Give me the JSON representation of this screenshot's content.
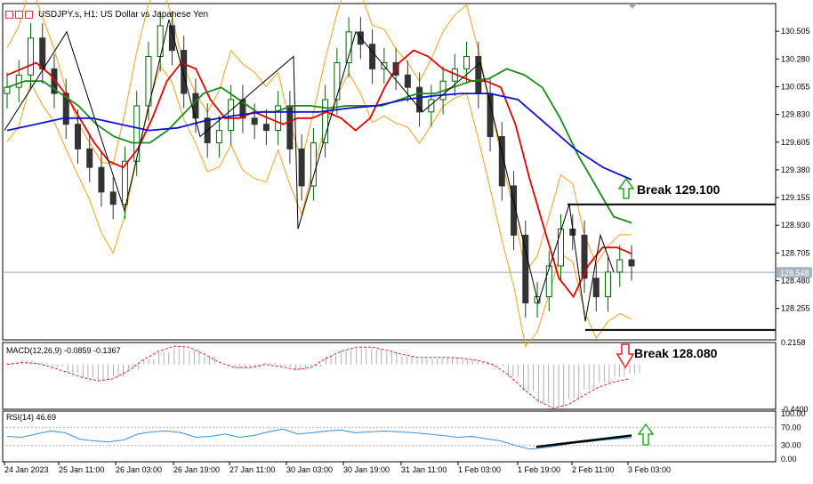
{
  "window": {
    "title": "USDJPY.s, H1:  US Dollar vs Japanese Yen"
  },
  "annotations": {
    "break_up": "Break 129.100",
    "break_down": "Break 128.080"
  },
  "indicators": {
    "macd_label": "MACD(12,26,9) -0.0859 -0.1367",
    "rsi_label": "RSI(14) 46.69"
  },
  "colors": {
    "bullish_candle": "#006400",
    "bearish_candle": "#333333",
    "ma_fast": "#e00000",
    "ma_mid": "#1a8a1a",
    "ma_slow": "#1010d0",
    "bollinger": "#f0a020",
    "up_arrow": "#22aa22",
    "down_arrow": "#dd2222",
    "rsi_line": "#3a8fd8",
    "macd_signal": "#dd2222",
    "histogram": "#b0b0b0"
  },
  "chart_data": {
    "type": "candlestick",
    "symbol": "USDJPY.s",
    "timeframe": "H1",
    "title": "USDJPY.s, H1:  US Dollar vs Japanese Yen",
    "ylim": [
      128.0,
      130.73
    ],
    "y_ticks": [
      "130.505",
      "130.280",
      "130.055",
      "129.830",
      "129.605",
      "129.380",
      "129.155",
      "128.930",
      "128.705",
      "128.480",
      "128.255"
    ],
    "current_price": "128.548",
    "x_tick_labels": [
      "24 Jan 2023",
      "25 Jan 11:00",
      "26 Jan 03:00",
      "26 Jan 19:00",
      "27 Jan 11:00",
      "30 Jan 03:00",
      "30 Jan 19:00",
      "31 Jan 11:00",
      "1 Feb 03:00",
      "1 Feb 19:00",
      "2 Feb 11:00",
      "3 Feb 03:00"
    ],
    "close_series": [
      130.05,
      130.15,
      130.45,
      130.2,
      130.0,
      129.75,
      129.55,
      129.4,
      129.2,
      129.1,
      129.45,
      129.9,
      130.3,
      130.55,
      130.35,
      130.0,
      129.8,
      129.6,
      129.7,
      129.95,
      129.8,
      129.75,
      129.7,
      129.9,
      129.55,
      129.25,
      129.6,
      129.95,
      130.25,
      130.5,
      130.4,
      130.2,
      130.25,
      130.15,
      130.05,
      129.85,
      129.95,
      130.1,
      130.2,
      130.3,
      130.0,
      129.65,
      129.25,
      128.85,
      128.3,
      128.35,
      128.6,
      128.9,
      128.85,
      128.5,
      128.35,
      128.55,
      128.65,
      128.6
    ],
    "support_line": 128.08,
    "resistance_line": 129.1,
    "series": [
      {
        "name": "MA fast",
        "color": "#e00000",
        "values": [
          130.15,
          130.2,
          130.25,
          130.15,
          130.0,
          129.8,
          129.6,
          129.45,
          129.4,
          129.55,
          129.8,
          130.1,
          130.25,
          130.2,
          129.95,
          129.8,
          129.8,
          129.85,
          129.8,
          129.75,
          129.8,
          129.8,
          129.85,
          129.8,
          129.7,
          129.8,
          130.05,
          130.25,
          130.35,
          130.3,
          130.2,
          130.15,
          130.1,
          130.1,
          130.05,
          129.75,
          129.3,
          128.9,
          128.5,
          128.35,
          128.6,
          128.75,
          128.75,
          128.7
        ]
      },
      {
        "name": "MA mid",
        "color": "#1a8a1a",
        "values": [
          130.05,
          130.1,
          130.1,
          130.0,
          129.9,
          129.75,
          129.65,
          129.6,
          129.6,
          129.7,
          129.85,
          130.0,
          130.05,
          129.95,
          129.85,
          129.85,
          129.9,
          129.9,
          129.88,
          129.9,
          129.9,
          129.9,
          129.95,
          130.0,
          130.0,
          130.05,
          130.1,
          130.12,
          130.2,
          130.15,
          130.05,
          129.8,
          129.5,
          129.25,
          129.0,
          128.95
        ]
      },
      {
        "name": "MA slow",
        "color": "#1010d0",
        "values": [
          129.7,
          129.75,
          129.8,
          129.8,
          129.75,
          129.7,
          129.72,
          129.78,
          129.82,
          129.85,
          129.85,
          129.85,
          129.88,
          129.9,
          129.95,
          129.98,
          130.0,
          130.0,
          129.95,
          129.75,
          129.55,
          129.4,
          129.3
        ]
      }
    ],
    "macd": {
      "ylim": [
        -0.44,
        0.2158
      ],
      "y_ticks": [
        "0.2158",
        "-0.4400"
      ],
      "macd_value": -0.0859,
      "signal_value": -0.1367,
      "histogram": [
        0.02,
        0.04,
        0.02,
        -0.02,
        -0.08,
        -0.13,
        -0.15,
        -0.12,
        -0.05,
        0.05,
        0.12,
        0.16,
        0.14,
        0.08,
        0.0,
        -0.04,
        -0.03,
        0.02,
        -0.02,
        -0.06,
        -0.02,
        0.08,
        0.14,
        0.16,
        0.15,
        0.12,
        0.08,
        0.05,
        0.06,
        0.07,
        0.05,
        0.03,
        -0.02,
        -0.12,
        -0.26,
        -0.38,
        -0.42,
        -0.34,
        -0.25,
        -0.18,
        -0.12,
        -0.09
      ],
      "signal": [
        0.0,
        0.02,
        0.01,
        -0.03,
        -0.08,
        -0.13,
        -0.16,
        -0.14,
        -0.06,
        0.05,
        0.13,
        0.18,
        0.17,
        0.1,
        0.02,
        -0.03,
        -0.03,
        0.0,
        -0.02,
        -0.05,
        -0.03,
        0.06,
        0.13,
        0.17,
        0.17,
        0.14,
        0.1,
        0.07,
        0.07,
        0.07,
        0.06,
        0.04,
        0.0,
        -0.1,
        -0.24,
        -0.36,
        -0.43,
        -0.39,
        -0.3,
        -0.22,
        -0.17,
        -0.14
      ]
    },
    "rsi": {
      "ylim": [
        0,
        100
      ],
      "y_ticks": [
        "100.00",
        "70.00",
        "30.00",
        "0.00"
      ],
      "value": 46.69,
      "values": [
        50,
        48,
        55,
        62,
        58,
        44,
        40,
        38,
        42,
        55,
        60,
        62,
        58,
        48,
        50,
        55,
        48,
        52,
        60,
        66,
        55,
        58,
        62,
        64,
        58,
        60,
        62,
        60,
        58,
        55,
        52,
        48,
        50,
        45,
        40,
        30,
        22,
        25,
        30,
        35,
        38,
        42,
        45,
        47
      ]
    }
  }
}
